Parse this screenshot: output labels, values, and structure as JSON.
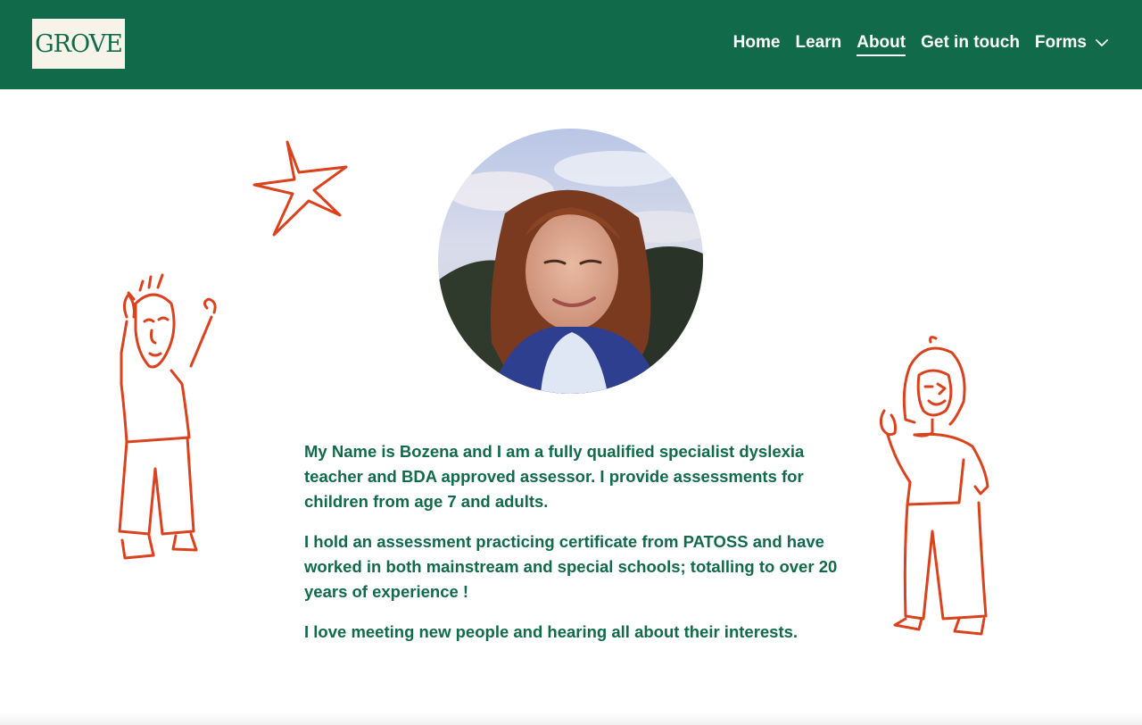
{
  "site": {
    "logo_text": "GROVE",
    "brand_color": "#116a4a",
    "accent_color": "#d9421c"
  },
  "nav": {
    "items": [
      {
        "label": "Home",
        "active": false
      },
      {
        "label": "Learn",
        "active": false
      },
      {
        "label": "About",
        "active": true
      },
      {
        "label": "Get in touch",
        "active": false
      },
      {
        "label": "Forms",
        "active": false,
        "has_dropdown": true
      }
    ],
    "dropdown_icon": "chevron-down-icon"
  },
  "main": {
    "paragraphs": [
      "My Name is Bozena and I am a fully qualified specialist dyslexia teacher and BDA approved assessor. I provide assessments for children from age 7 and adults.",
      "I hold an assessment practicing certificate from PATOSS and have worked in both mainstream and special schools; totalling to over 20 years of experience !",
      "I love meeting new people and hearing all about their interests."
    ]
  }
}
